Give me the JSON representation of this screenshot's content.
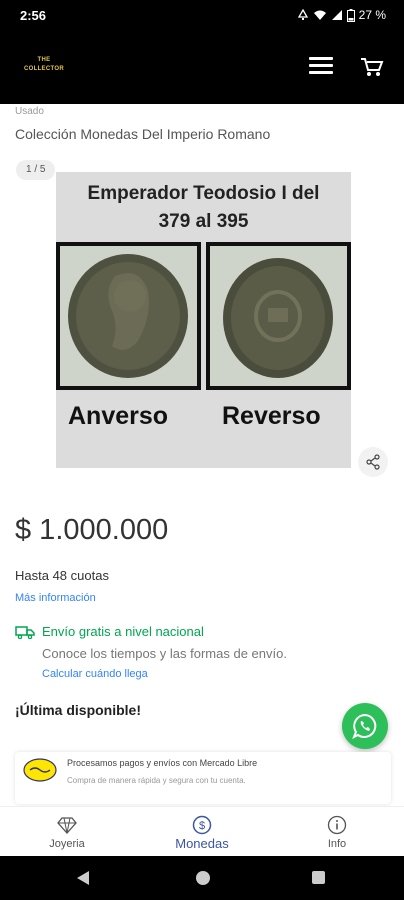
{
  "status_bar": {
    "time": "2:56",
    "battery": "27 %"
  },
  "app_bar": {
    "logo_line1": "THE",
    "logo_line2": "COLLECTOR",
    "brand_color": "#e8c64a"
  },
  "product": {
    "condition": "Usado",
    "title": "Colección Monedas Del Imperio Romano",
    "image_counter": "1 / 5",
    "image": {
      "title_line1": "Emperador Teodosio I del",
      "title_line2": "379 al 395",
      "left_label": "Anverso",
      "right_label": "Reverso"
    },
    "price": "$ 1.000.000",
    "installments": "Hasta 48 cuotas",
    "more_info": "Más información"
  },
  "shipping": {
    "title": "Envío gratis a nivel nacional",
    "subtitle": "Conoce los tiempos y las formas de envío.",
    "link": "Calcular cuándo llega",
    "accent_color": "#00a650"
  },
  "stock": {
    "label": "¡Última disponible!"
  },
  "mercado_pago": {
    "title": "Procesamos pagos y envíos con Mercado Libre",
    "subtitle": "Compra de manera rápida y segura con tu cuenta."
  },
  "bottom_nav": {
    "items": [
      {
        "label": "Joyeria",
        "icon": "diamond-icon"
      },
      {
        "label": "Monedas",
        "icon": "coin-dollar-icon"
      },
      {
        "label": "Info",
        "icon": "info-icon"
      }
    ],
    "active_index": 1,
    "active_color": "#3a56a5"
  },
  "colors": {
    "link": "#3483fa",
    "whatsapp": "#2dbf59"
  }
}
